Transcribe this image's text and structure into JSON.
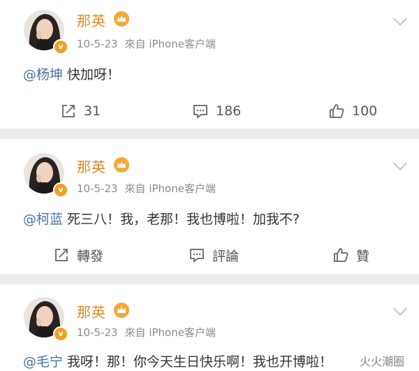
{
  "posts": [
    {
      "author": "那英",
      "date": "10-5-23",
      "source": "來自 iPhone客户端",
      "mention": "@杨坤",
      "text": " 快加呀！",
      "actions": {
        "repost": "31",
        "comment": "186",
        "like": "100"
      }
    },
    {
      "author": "那英",
      "date": "10-5-23",
      "source": "來自 iPhone客户端",
      "mention": "@柯蓝",
      "text": " 死三八！我，老那！我也博啦！加我不?",
      "actions": {
        "repost": "轉發",
        "comment": "評論",
        "like": "贊"
      }
    },
    {
      "author": "那英",
      "date": "10-5-23",
      "source": "來自 iPhone客户端",
      "mention": "@毛宁",
      "text": " 我呀！那！你今天生日快乐啊！我也开博啦！",
      "actions": {
        "repost": "",
        "comment": "",
        "like": ""
      }
    }
  ],
  "watermark": "火火潮圈",
  "colors": {
    "author": "#e08a1e",
    "mention": "#4b73a7",
    "vip_badge": "#f0a028",
    "meta": "#8d8d8d"
  }
}
